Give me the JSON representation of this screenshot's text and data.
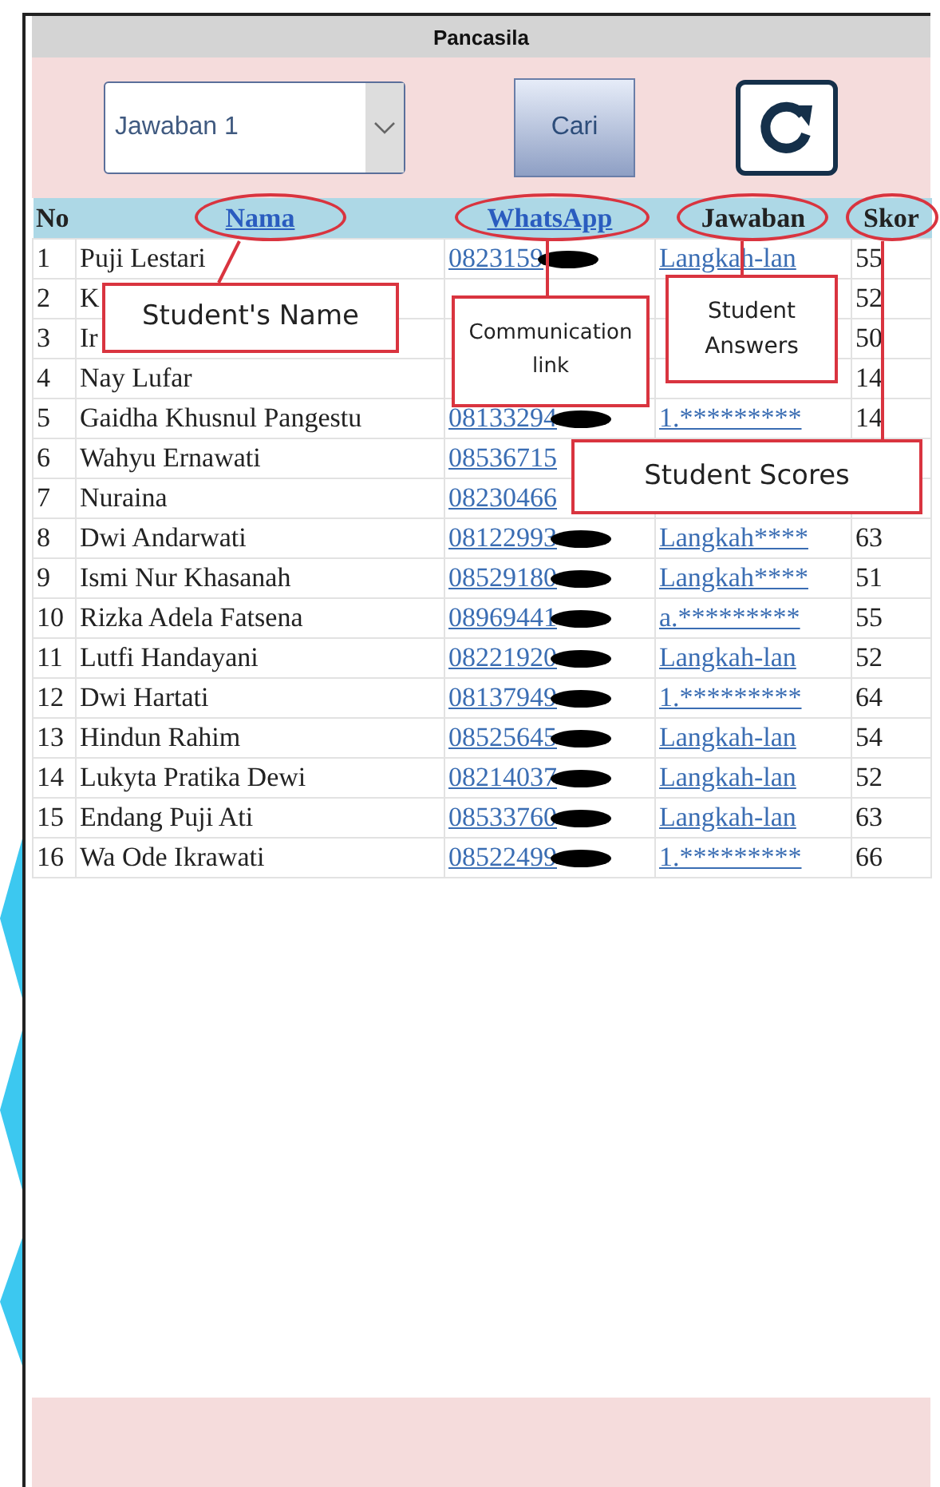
{
  "window": {
    "title": "Pancasila"
  },
  "controls": {
    "dropdown": {
      "value": "Jawaban 1"
    },
    "search_button": "Cari"
  },
  "table": {
    "columns": [
      {
        "label": "No",
        "link": false
      },
      {
        "label": "Nama",
        "link": true
      },
      {
        "label": "WhatsApp",
        "link": true
      },
      {
        "label": "Jawaban",
        "link": false
      },
      {
        "label": "Skor",
        "link": false
      }
    ],
    "rows": [
      {
        "no": "1",
        "name": "Puji Lestari",
        "whatsapp": "0823159",
        "redacted": true,
        "answer": "Langkah-lan",
        "score": "55"
      },
      {
        "no": "2",
        "name": "K",
        "score": "52"
      },
      {
        "no": "3",
        "name": "Ir",
        "score": "50"
      },
      {
        "no": "4",
        "name": "Nay Lufar",
        "score": "14"
      },
      {
        "no": "5",
        "name": "Gaidha Khusnul Pangestu",
        "whatsapp": "08133294",
        "redacted": true,
        "answer": "1.*********",
        "score": "14"
      },
      {
        "no": "6",
        "name": "Wahyu Ernawati",
        "whatsapp": "08536715",
        "redacted": false
      },
      {
        "no": "7",
        "name": "Nuraina",
        "whatsapp": "08230466",
        "redacted": false
      },
      {
        "no": "8",
        "name": "Dwi Andarwati",
        "whatsapp": "08122993",
        "redacted": true,
        "answer": "Langkah****",
        "score": "63"
      },
      {
        "no": "9",
        "name": "Ismi Nur Khasanah",
        "whatsapp": "08529180",
        "redacted": true,
        "answer": "Langkah****",
        "score": "51"
      },
      {
        "no": "10",
        "name": "Rizka Adela Fatsena",
        "whatsapp": "08969441",
        "redacted": true,
        "answer": "a.*********",
        "score": "55"
      },
      {
        "no": "11",
        "name": "Lutfi Handayani",
        "whatsapp": "08221920",
        "redacted": true,
        "answer": "Langkah-lan",
        "score": "52"
      },
      {
        "no": "12",
        "name": "Dwi Hartati",
        "whatsapp": "08137949",
        "redacted": true,
        "answer": "1.*********",
        "score": "64"
      },
      {
        "no": "13",
        "name": "Hindun Rahim",
        "whatsapp": "08525645",
        "redacted": true,
        "answer": "Langkah-lan",
        "score": "54"
      },
      {
        "no": "14",
        "name": "Lukyta Pratika Dewi",
        "whatsapp": "08214037",
        "redacted": true,
        "answer": "Langkah-lan",
        "score": "52"
      },
      {
        "no": "15",
        "name": "Endang Puji Ati",
        "whatsapp": "08533760",
        "redacted": true,
        "answer": "Langkah-lan",
        "score": "63"
      },
      {
        "no": "16",
        "name": "Wa Ode Ikrawati",
        "whatsapp": "08522499",
        "redacted": true,
        "answer": "1.*********",
        "score": "66"
      }
    ]
  },
  "annotations": [
    {
      "text": "Student's Name"
    },
    {
      "text": "Communication link"
    },
    {
      "text": "Student Answers"
    },
    {
      "text": "Student Scores"
    }
  ]
}
